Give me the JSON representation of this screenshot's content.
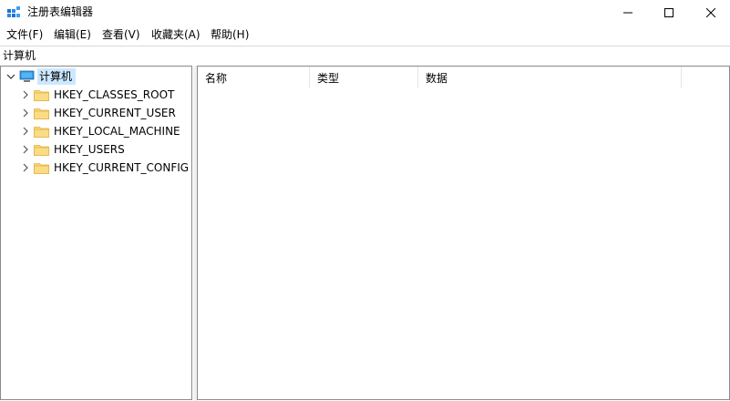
{
  "window": {
    "title": "注册表编辑器"
  },
  "menu": [
    "文件(F)",
    "编辑(E)",
    "查看(V)",
    "收藏夹(A)",
    "帮助(H)"
  ],
  "address": "计算机",
  "tree": {
    "root": "计算机",
    "children": [
      "HKEY_CLASSES_ROOT",
      "HKEY_CURRENT_USER",
      "HKEY_LOCAL_MACHINE",
      "HKEY_USERS",
      "HKEY_CURRENT_CONFIG"
    ]
  },
  "columns": [
    "名称",
    "类型",
    "数据"
  ],
  "icons": {
    "app": "regedit-icon",
    "folder": "folder-icon",
    "computer": "computer-icon"
  },
  "colors": {
    "selection": "#cce8ff",
    "folder": "#f8d775",
    "folder_dark": "#e9b949"
  }
}
